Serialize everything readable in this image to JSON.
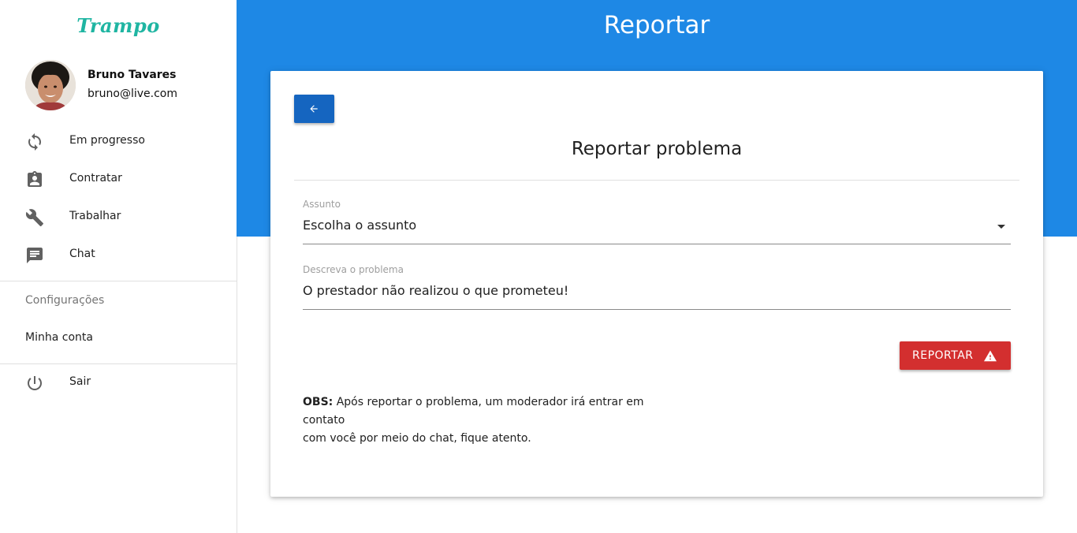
{
  "app": {
    "logo_text": "Trampo"
  },
  "user": {
    "name": "Bruno Tavares",
    "email": "bruno@live.com"
  },
  "sidebar": {
    "items": [
      {
        "label": "Em progresso",
        "icon": "sync-icon"
      },
      {
        "label": "Contratar",
        "icon": "assignment-ind-icon"
      },
      {
        "label": "Trabalhar",
        "icon": "wrench-icon"
      },
      {
        "label": "Chat",
        "icon": "chat-icon"
      }
    ],
    "settings_header": "Configurações",
    "account_label": "Minha conta",
    "logout_label": "Sair",
    "logout_icon": "power-icon"
  },
  "header": {
    "title": "Reportar"
  },
  "card": {
    "title": "Reportar problema",
    "subject_label": "Assunto",
    "subject_value": "Escolha o assunto",
    "description_label": "Descreva o problema",
    "description_value": "O prestador não realizou o que prometeu!",
    "report_button_label": "REPORTAR",
    "obs_prefix": "OBS:",
    "obs_line1": "Após reportar o problema, um moderador irá entrar em contato",
    "obs_line2": "com você por meio do chat, fique atento."
  },
  "colors": {
    "primary": "#1e88e5",
    "back_button": "#1565c0",
    "danger": "#d32f2f",
    "logo": "#1fb5a2"
  }
}
